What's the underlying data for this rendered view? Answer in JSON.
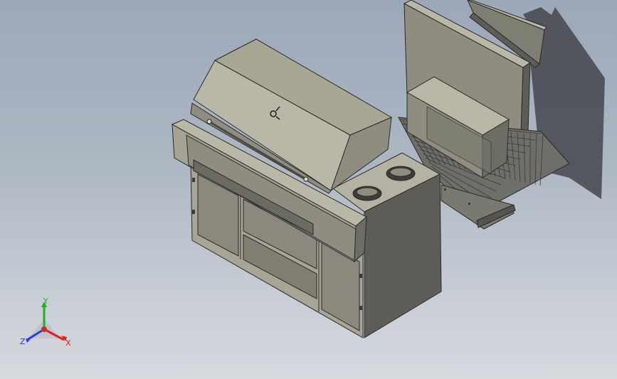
{
  "viewport": {
    "background_top": "#9ba8b8",
    "background_bottom": "#d6d9de"
  },
  "model": {
    "parts": [
      "grill-body",
      "grill-hood",
      "grill-cabinet",
      "side-burner-cabinet",
      "side-burner-hole",
      "wire-rack",
      "back-panel",
      "top-panel",
      "burner-box"
    ],
    "colors": {
      "light_face": "#b9b8a6",
      "mid_face": "#8f8d7f",
      "dark_face": "#5d5c57",
      "edge": "#2a2a28",
      "shadow": "#4a4c52"
    }
  },
  "triad": {
    "x_label": "X",
    "y_label": "Y",
    "z_label": "Z",
    "x_color": "#e02020",
    "y_color": "#20b020",
    "z_color": "#2040e0"
  }
}
